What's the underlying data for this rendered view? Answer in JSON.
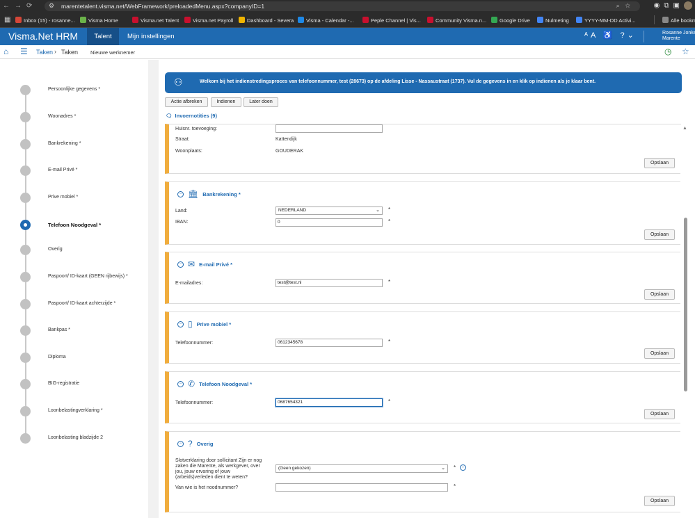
{
  "browser": {
    "url": "marentetalent.visma.net/WebFramework/preloadedMenu.aspx?companyID=1",
    "bookmarks": [
      {
        "label": "Inbox (15) - rosanne...",
        "color": "#d44638"
      },
      {
        "label": "Visma Home",
        "color": "#6bb34a"
      },
      {
        "label": "Visma.net Talent",
        "color": "#c8102e"
      },
      {
        "label": "Visma.net Payroll",
        "color": "#c8102e"
      },
      {
        "label": "Dashboard - Severa",
        "color": "#f0b400"
      },
      {
        "label": "Visma - Calendar -...",
        "color": "#1e88e5"
      },
      {
        "label": "Peple Channel | Vis...",
        "color": "#c8102e"
      },
      {
        "label": "Community Visma.n...",
        "color": "#c8102e"
      },
      {
        "label": "Google Drive",
        "color": "#34a853"
      },
      {
        "label": "Nulmeting",
        "color": "#4285f4"
      },
      {
        "label": "YYYY-MM-DD Activi...",
        "color": "#4285f4"
      },
      {
        "label": "Alle bookm",
        "color": "#888888"
      }
    ]
  },
  "header": {
    "logo": "Visma.Net HRM",
    "tabs": [
      "Talent",
      "Mijn instellingen"
    ],
    "user_name": "Rosanne Jonke",
    "company": "Marente"
  },
  "breadcrumb": {
    "items": [
      "Taken",
      "Taken",
      "Nieuwe werknemer"
    ],
    "separator": "›"
  },
  "steps": [
    {
      "label": "Persoonlijke gegevens *"
    },
    {
      "label": "Woonadres *"
    },
    {
      "label": "Bankrekening *"
    },
    {
      "label": "E-mail Privé *"
    },
    {
      "label": "Prive mobiel *"
    },
    {
      "label": "Telefoon Noodgeval *"
    },
    {
      "label": "Overig"
    },
    {
      "label": "Paspoort/ ID-kaart (GEEN rijbewijs) *"
    },
    {
      "label": "Paspoort/ ID-kaart achterzijde *"
    },
    {
      "label": "Bankpas *"
    },
    {
      "label": "Diploma"
    },
    {
      "label": "BIG-registratie"
    },
    {
      "label": "Loonbelastingverklaring *"
    },
    {
      "label": "Loonbelasting bladzijde 2"
    }
  ],
  "welcome_message": "Welkom bij het indienstredingsproces van telefoonnummer, test (28673) op de afdeling Lisse - Nassaustraat (1737). Vul de gegevens in en klik op indienen als je klaar bent.",
  "actions": {
    "cancel": "Actie afbreken",
    "submit": "Indienen",
    "later": "Later doen"
  },
  "notes_label": "Invoernotities (9)",
  "save_label": "Opslaan",
  "address": {
    "addition_label": "Huisnr. toevoeging:",
    "addition_value": "",
    "street_label": "Straat:",
    "street_value": "Kattendijk",
    "city_label": "Woonplaats:",
    "city_value": "GOUDERAK"
  },
  "bank": {
    "title": "Bankrekening *",
    "country_label": "Land:",
    "country_value": "NEDERLAND",
    "iban_label": "IBAN:",
    "iban_value": "0"
  },
  "email": {
    "title": "E-mail Privé *",
    "label": "E-mailadres:",
    "value": "test@test.nl"
  },
  "mobile": {
    "title": "Prive mobiel *",
    "label": "Telefoonnummer:",
    "value": "0612345678"
  },
  "emergency": {
    "title": "Telefoon Noodgeval *",
    "label": "Telefoonnummer:",
    "value": "0687654321"
  },
  "other": {
    "title": "Overig",
    "question1": "Slotverklaring door sollicitant Zijn er nog zaken die Marente, als werkgever, over jou, jouw ervaring of jouw (arbeids)verleden dient te weten?",
    "question1_value": "(Geen gekozen)",
    "question2": "Van wie is het noodnummer?",
    "question2_value": ""
  },
  "required_mark": "*",
  "colors": {
    "brand": "#1f6ab1",
    "accent_bar": "#f0ad3e",
    "active_step": "#1f6ab1"
  }
}
